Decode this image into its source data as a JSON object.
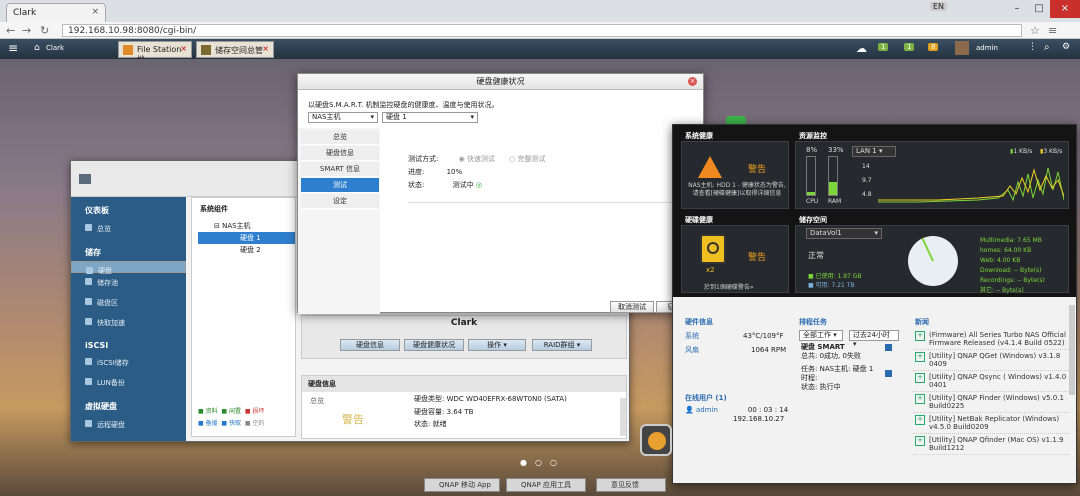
{
  "browser": {
    "tab_title": "Clark",
    "url": "192.168.10.98:8080/cgi-bin/",
    "account": "admin"
  },
  "qnap": {
    "host": "Clark",
    "tabs": [
      "File Station 档...",
      "储存空间总管"
    ],
    "user": "admin",
    "badges": [
      "1",
      "1",
      "8"
    ]
  },
  "smart_dialog": {
    "title": "硬盘健康状况",
    "desc": "以硬盘S.M.A.R.T. 机制监控硬盘的健康度、温度与使用状况。",
    "nas_select": "NAS主机",
    "disk_select": "硬盘 1",
    "menu": [
      "总览",
      "硬盘信息",
      "SMART 信息",
      "测试",
      "设定"
    ],
    "active_menu": "测试",
    "test_mode_label": "测试方式:",
    "quick": "快速测试",
    "full": "完整测试",
    "progress_label": "进度:",
    "progress_value": "10%",
    "status_label": "状态:",
    "status_value": "测试中",
    "cancel": "取消测试",
    "start": "征"
  },
  "storage": {
    "sidebar": [
      {
        "h": "仪表板",
        "items": [
          "总览"
        ]
      },
      {
        "h": "储存",
        "items": [
          "硬盘",
          "储存池",
          "磁盘区",
          "快取加速"
        ]
      },
      {
        "h": "iSCSI",
        "items": [
          "iSCSI储存",
          "LUN备份"
        ]
      },
      {
        "h": "虚拟硬盘",
        "items": [
          "远程硬盘"
        ]
      }
    ],
    "tree_title": "系统组件",
    "tree_root": "NAS主机",
    "tree_items": [
      "硬盘 1",
      "硬盘 2"
    ],
    "host": "Clark",
    "buttons": [
      "硬盘信息",
      "硬盘健康状况",
      "操作 ▾",
      "RAID群组 ▾"
    ],
    "legend": [
      "资料",
      "闲置",
      "损坏",
      "备援",
      "快取",
      "空的"
    ],
    "info_title": "硬盘信息",
    "info_tab": "总览",
    "info_warn": "警告",
    "type_label": "硬盘类型:",
    "type_value": "WDC WD40EFRX-68WT0N0 (SATA)",
    "cap_label": "硬盘容量:",
    "cap_value": "3.64 TB",
    "status_label": "状态:",
    "status_value": "就绪"
  },
  "dashboard": {
    "sys_health": "系统健康",
    "warn": "警告",
    "sys_msg": "NAS主机: HDD 1 - 健康状态为警告,请查看[硬碟健康]以取得详细信息",
    "res": "资源监控",
    "cpu_pct": "8%",
    "ram_pct": "33%",
    "cpu": "CPU",
    "ram": "RAM",
    "lan": "LAN 1",
    "lan_rx": "1 KB/s",
    "lan_tx": "3 KB/s",
    "ticks": [
      "14",
      "9.7",
      "4.8"
    ],
    "disk_health": "硬碟健康",
    "disk_warn": "警告",
    "disk_count": "x2",
    "disk_msg": "於到1個硬碟警告»",
    "storage": "储存空间",
    "vol": "DataVol1",
    "normal": "正常",
    "used": "已使用: 1.97 GB",
    "free": "可用: 7.21 TB",
    "vol_items": [
      "Multimedia: 7.65 MB",
      "homes: 64.00 KB",
      "Web: 4.00 KB",
      "Download: -- Byte(s)",
      "Recordings: -- Byte(s)",
      "其它: -- Byte(s)"
    ],
    "hw": "硬件信息",
    "sys_label": "系统",
    "sys_val": "43°C/109°F",
    "fan_label": "风扇",
    "fan_val": "1064 RPM",
    "tasks": "排程任务",
    "task_sel1": "全部工作",
    "task_sel2": "过去24小时",
    "smart_title": "硬盘 SMART",
    "smart_total": "总共: 0成功, 0失败",
    "task_l": [
      "任务:",
      "时程:",
      "状态:"
    ],
    "task_v": [
      "NAS主机: 硬盘 1",
      "",
      "执行中"
    ],
    "online": "在线用户 (1)",
    "user": "admin",
    "user_time": "00 : 03 : 14",
    "user_ip": "192.168.10.27",
    "news_title": "新闻",
    "news": [
      "(Firmware) All Series Turbo NAS Official Firmware Released (v4.1.4 Build 0522)",
      "[Utility] QNAP QGet (Windows) v3.1.8 0409",
      "[Utility] QNAP Qsync ( Windows) v1.4.0 0401",
      "[Utility] QNAP Finder (Windows) v5.0.1 Build0225",
      "[Utility] NetBak Replicator (Windows) v4.5.0 Build0209",
      "[Utility] QNAP Qfinder (Mac OS) v1.1.9 Build1212"
    ]
  },
  "taskbar": [
    "QNAP 移动 App",
    "QNAP 应用工具",
    "意见反馈"
  ],
  "colors": {
    "sidebar": "#2b5c86",
    "accent": "#2f7fcf",
    "warn": "#f0a020"
  }
}
